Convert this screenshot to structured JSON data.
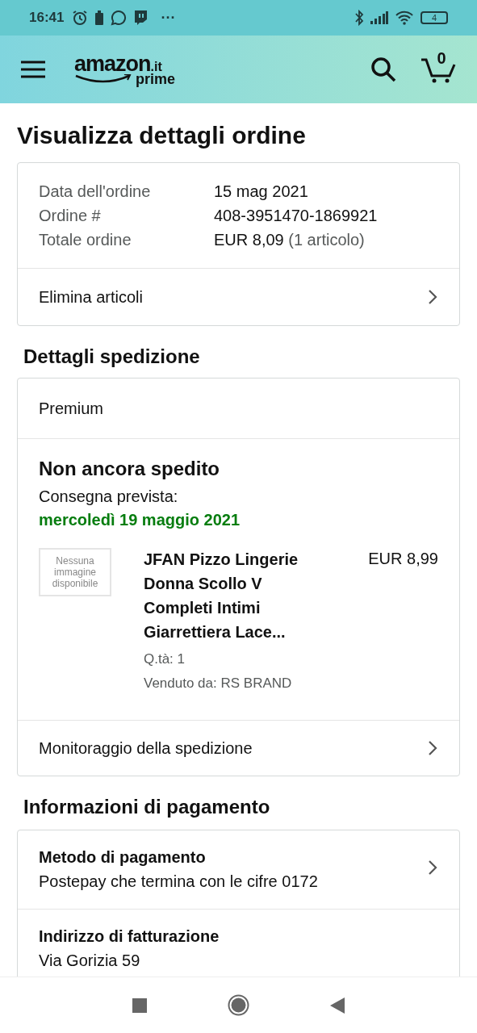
{
  "status_bar": {
    "time": "16:41",
    "more": "···",
    "battery": "4"
  },
  "header": {
    "logo": {
      "brand": "amazon",
      "domain": ".it",
      "tier": "prime"
    },
    "cart_count": "0"
  },
  "title": "Visualizza dettagli ordine",
  "order_summary": {
    "rows": [
      {
        "label": "Data dell'ordine",
        "value": "15 mag 2021",
        "note": ""
      },
      {
        "label": "Ordine #",
        "value": "408-3951470-1869921",
        "note": ""
      },
      {
        "label": "Totale ordine",
        "value": "EUR 8,09",
        "note": "(1 articolo)"
      }
    ],
    "link": "Elimina articoli"
  },
  "shipping": {
    "heading": "Dettagli spedizione",
    "service": "Premium",
    "status": "Non ancora spedito",
    "delivery_label": "Consegna prevista:",
    "delivery_date": "mercoledì 19 maggio 2021",
    "item": {
      "image_placeholder": "Nessuna immagine disponibile",
      "name": "JFAN Pizzo Lingerie Donna Scollo V Completi Intimi Giarrettiera Lace...",
      "price": "EUR 8,99",
      "quantity": "Q.tà: 1",
      "seller": "Venduto da: RS BRAND"
    },
    "link": "Monitoraggio della spedizione"
  },
  "payment": {
    "heading": "Informazioni di pagamento",
    "rows": [
      {
        "title": "Metodo di pagamento",
        "detail": "Postepay che termina con le cifre 0172",
        "chevron": true
      },
      {
        "title": "Indirizzo di fatturazione",
        "detail": "Via Gorizia 59",
        "chevron": false
      }
    ]
  }
}
